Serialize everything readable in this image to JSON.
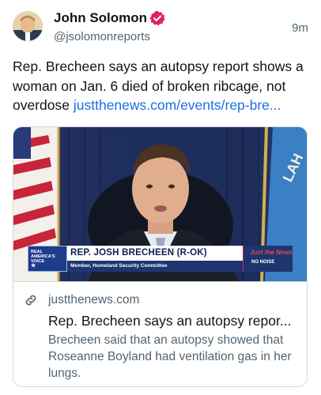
{
  "author": {
    "name": "John Solomon",
    "handle": "@jsolomonreports",
    "verified": true
  },
  "timestamp": "9m",
  "post": {
    "text": "Rep. Brecheen says an autopsy report shows a woman on Jan. 6 died of broken ribcage, not overdose",
    "link_text": "justthenews.com/events/rep-bre..."
  },
  "card": {
    "domain": "justthenews.com",
    "title": "Rep. Brecheen says an autopsy repor...",
    "description": "Brecheen said that an autopsy showed that Roseanne Boyland had ventilation gas in her lungs.",
    "chyron": {
      "logo_line1": "REAL",
      "logo_line2": "AMERICA'S",
      "logo_line3": "VOICE",
      "name": "REP. JOSH BRECHEEN (R-OK)",
      "subtitle": "Member, Homeland Security Committee",
      "side_top": "Just the News",
      "side_bottom": "NO NOISE"
    }
  },
  "colors": {
    "link": "#1d6fe0",
    "verified_badge": "#e0245e",
    "secondary_text": "#536471"
  }
}
